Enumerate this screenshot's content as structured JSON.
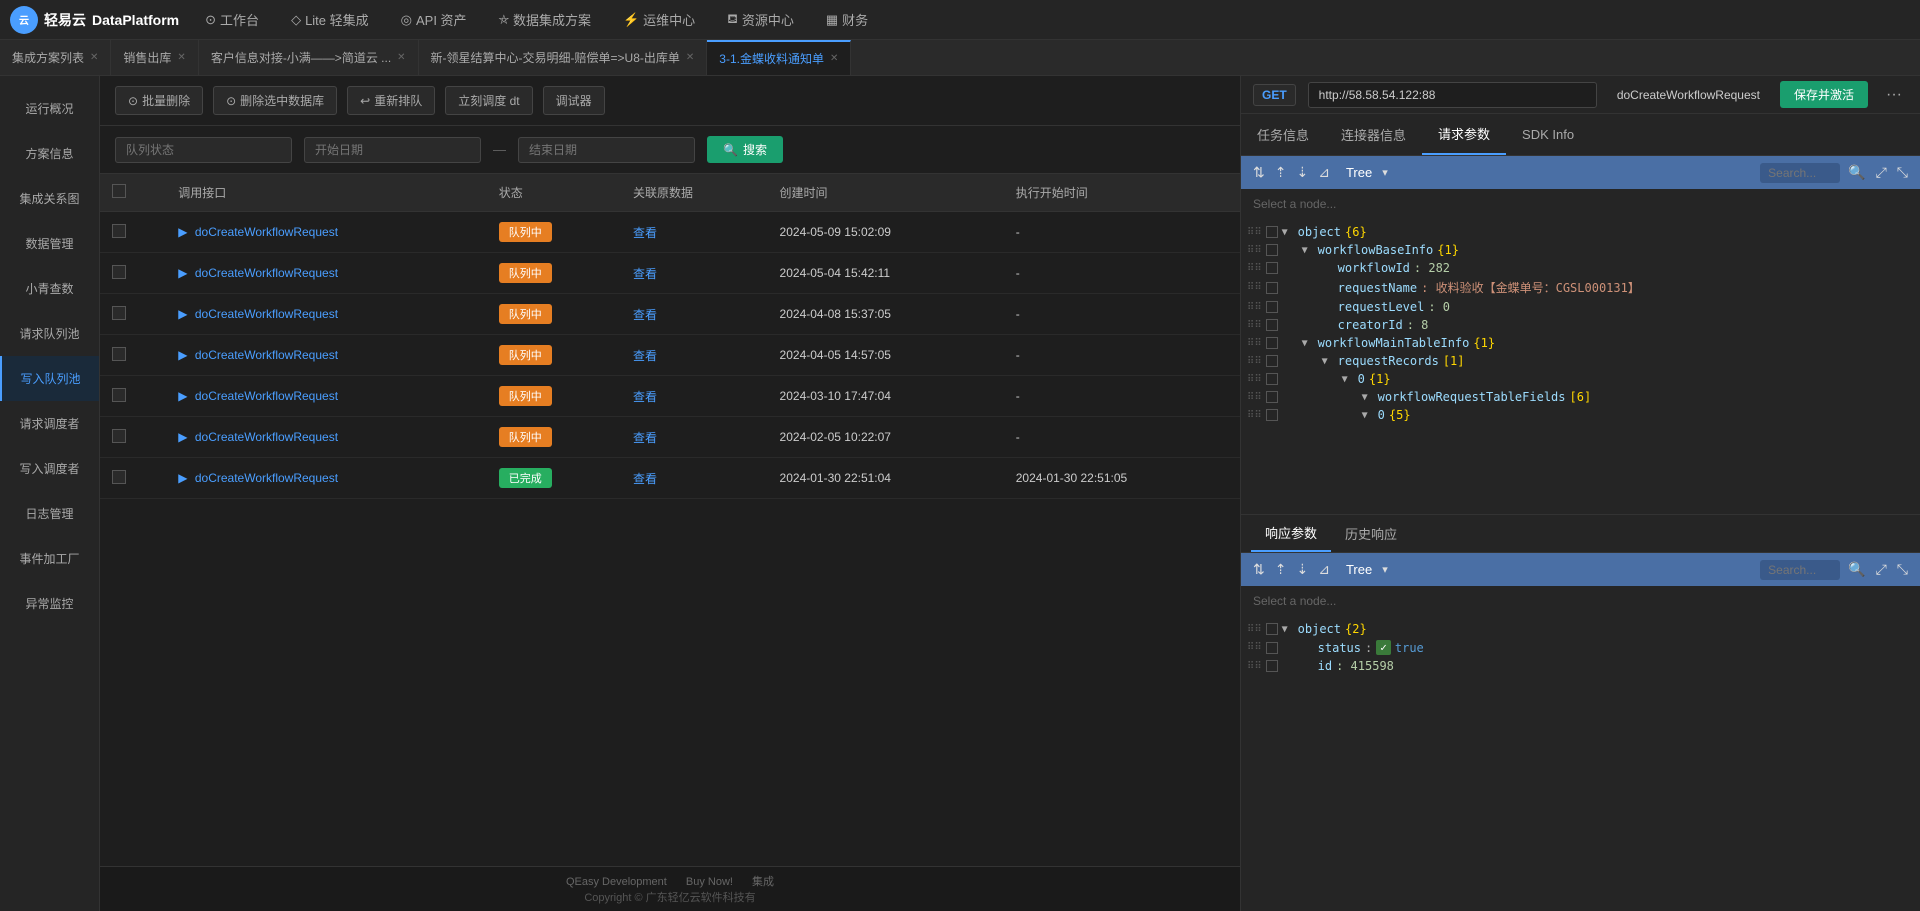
{
  "app": {
    "logo_text": "轻易云",
    "app_name": "DataPlatform"
  },
  "top_nav": {
    "items": [
      {
        "id": "workbench",
        "label": "工作台",
        "icon": "⊙"
      },
      {
        "id": "lite",
        "label": "Lite 轻集成",
        "icon": "◇"
      },
      {
        "id": "api",
        "label": "API 资产",
        "icon": "◎"
      },
      {
        "id": "integration",
        "label": "数据集成方案",
        "icon": "⛤"
      },
      {
        "id": "ops",
        "label": "运维中心",
        "icon": "⚡"
      },
      {
        "id": "resources",
        "label": "资源中心",
        "icon": "⛾"
      },
      {
        "id": "finance",
        "label": "财务",
        "icon": "▦"
      }
    ]
  },
  "tabs": [
    {
      "id": "solution-list",
      "label": "集成方案列表",
      "active": false
    },
    {
      "id": "sales-warehouse",
      "label": "销售出库",
      "active": false
    },
    {
      "id": "customer-info",
      "label": "客户信息对接-小满——>简道云 ...",
      "active": false
    },
    {
      "id": "new-star",
      "label": "新-领星结算中心-交易明细-赔偿单=>U8-出库单",
      "active": false
    },
    {
      "id": "golden-butterfly",
      "label": "3-1.金蝶收料通知单",
      "active": true
    }
  ],
  "sidebar": {
    "items": [
      {
        "id": "overview",
        "label": "运行概况",
        "active": false
      },
      {
        "id": "solution-info",
        "label": "方案信息",
        "active": false
      },
      {
        "id": "integration-map",
        "label": "集成关系图",
        "active": false
      },
      {
        "id": "data-mgmt",
        "label": "数据管理",
        "active": false
      },
      {
        "id": "small-query",
        "label": "小青查数",
        "active": false
      },
      {
        "id": "request-queue",
        "label": "请求队列池",
        "active": false
      },
      {
        "id": "write-queue",
        "label": "写入队列池",
        "active": true
      },
      {
        "id": "request-scheduler",
        "label": "请求调度者",
        "active": false
      },
      {
        "id": "write-scheduler",
        "label": "写入调度者",
        "active": false
      },
      {
        "id": "log-mgmt",
        "label": "日志管理",
        "active": false
      },
      {
        "id": "event-factory",
        "label": "事件加工厂",
        "active": false
      },
      {
        "id": "anomaly-monitor",
        "label": "异常监控",
        "active": false
      }
    ]
  },
  "toolbar": {
    "batch_delete": "批量删除",
    "delete_selected": "删除选中数据库",
    "requeue": "重新排队",
    "schedule_now": "立刻调度 dt",
    "debug": "调试器"
  },
  "filter": {
    "queue_status_placeholder": "队列状态",
    "start_date_placeholder": "开始日期",
    "end_date_placeholder": "结束日期",
    "separator": "—",
    "search_label": "搜索"
  },
  "table": {
    "columns": [
      "",
      "调用接口",
      "状态",
      "关联原数据",
      "创建时间",
      "执行开始时间"
    ],
    "rows": [
      {
        "api": "doCreateWorkflowRequest",
        "status": "队列中",
        "status_type": "queue",
        "related": "查看",
        "created": "2024-05-09 15:02:09",
        "started": "-"
      },
      {
        "api": "doCreateWorkflowRequest",
        "status": "队列中",
        "status_type": "queue",
        "related": "查看",
        "created": "2024-05-04 15:42:11",
        "started": "-"
      },
      {
        "api": "doCreateWorkflowRequest",
        "status": "队列中",
        "status_type": "queue",
        "related": "查看",
        "created": "2024-04-08 15:37:05",
        "started": "-"
      },
      {
        "api": "doCreateWorkflowRequest",
        "status": "队列中",
        "status_type": "queue",
        "related": "查看",
        "created": "2024-04-05 14:57:05",
        "started": "-"
      },
      {
        "api": "doCreateWorkflowRequest",
        "status": "队列中",
        "status_type": "queue",
        "related": "查看",
        "created": "2024-03-10 17:47:04",
        "started": "-"
      },
      {
        "api": "doCreateWorkflowRequest",
        "status": "队列中",
        "status_type": "queue",
        "related": "查看",
        "created": "2024-02-05 10:22:07",
        "started": "-"
      },
      {
        "api": "doCreateWorkflowRequest",
        "status": "已完成",
        "status_type": "done",
        "related": "查看",
        "created": "2024-01-30 22:51:04",
        "started": "2024-01-30 22:51:05"
      }
    ]
  },
  "right_panel": {
    "method": "GET",
    "url": "http://58.58.54.122:88",
    "function_name": "doCreateWorkflowRequest",
    "save_activate": "保存并激活",
    "more": "···",
    "tabs": [
      {
        "id": "task-info",
        "label": "任务信息",
        "active": false
      },
      {
        "id": "connector-info",
        "label": "连接器信息",
        "active": false
      },
      {
        "id": "request-params",
        "label": "请求参数",
        "active": true
      },
      {
        "id": "sdk-info",
        "label": "SDK Info",
        "active": false
      }
    ],
    "request_tree": {
      "placeholder": "Select a node...",
      "header_label": "Tree",
      "nodes": [
        {
          "indent": 0,
          "key": "object",
          "value": "{6}",
          "arrow": "▼",
          "type": "brace"
        },
        {
          "indent": 1,
          "key": "workflowBaseInfo",
          "value": "{1}",
          "arrow": "▼",
          "type": "brace"
        },
        {
          "indent": 2,
          "key": "workflowId",
          "value": ": 282",
          "arrow": "",
          "type": "number"
        },
        {
          "indent": 2,
          "key": "requestName",
          "value": ": 收料验收【金蝶单号：CGSL000131】",
          "arrow": "",
          "type": "string"
        },
        {
          "indent": 2,
          "key": "requestLevel",
          "value": ": 0",
          "arrow": "",
          "type": "number"
        },
        {
          "indent": 2,
          "key": "creatorId",
          "value": ": 8",
          "arrow": "",
          "type": "number"
        },
        {
          "indent": 1,
          "key": "workflowMainTableInfo",
          "value": "{1}",
          "arrow": "▼",
          "type": "brace"
        },
        {
          "indent": 2,
          "key": "requestRecords",
          "value": "[1]",
          "arrow": "▼",
          "type": "brace"
        },
        {
          "indent": 3,
          "key": "0",
          "value": "{1}",
          "arrow": "▼",
          "type": "brace"
        },
        {
          "indent": 4,
          "key": "workflowRequestTableFields",
          "value": "[6]",
          "arrow": "▼",
          "type": "brace"
        },
        {
          "indent": 4,
          "key": "0",
          "value": "{5}",
          "arrow": "▼",
          "type": "brace"
        }
      ]
    },
    "bottom_tabs": [
      {
        "id": "response-params",
        "label": "响应参数",
        "active": true
      },
      {
        "id": "history-response",
        "label": "历史响应",
        "active": false
      }
    ],
    "response_tree": {
      "placeholder": "Select a node...",
      "header_label": "Tree",
      "nodes": [
        {
          "indent": 0,
          "key": "object",
          "value": "{2}",
          "arrow": "▼",
          "type": "brace"
        },
        {
          "indent": 1,
          "key": "status",
          "value": ": ✓ true",
          "arrow": "",
          "type": "bool",
          "has_checkbox": true
        },
        {
          "indent": 1,
          "key": "id",
          "value": ": 415598",
          "arrow": "",
          "type": "number"
        }
      ]
    }
  },
  "footer": {
    "links": [
      "QEasy Development",
      "Buy Now!",
      "集成"
    ],
    "copyright": "Copyright © 广东轻亿云软件科技有"
  },
  "watermark": "广东轻亿云软件科技有限公司"
}
